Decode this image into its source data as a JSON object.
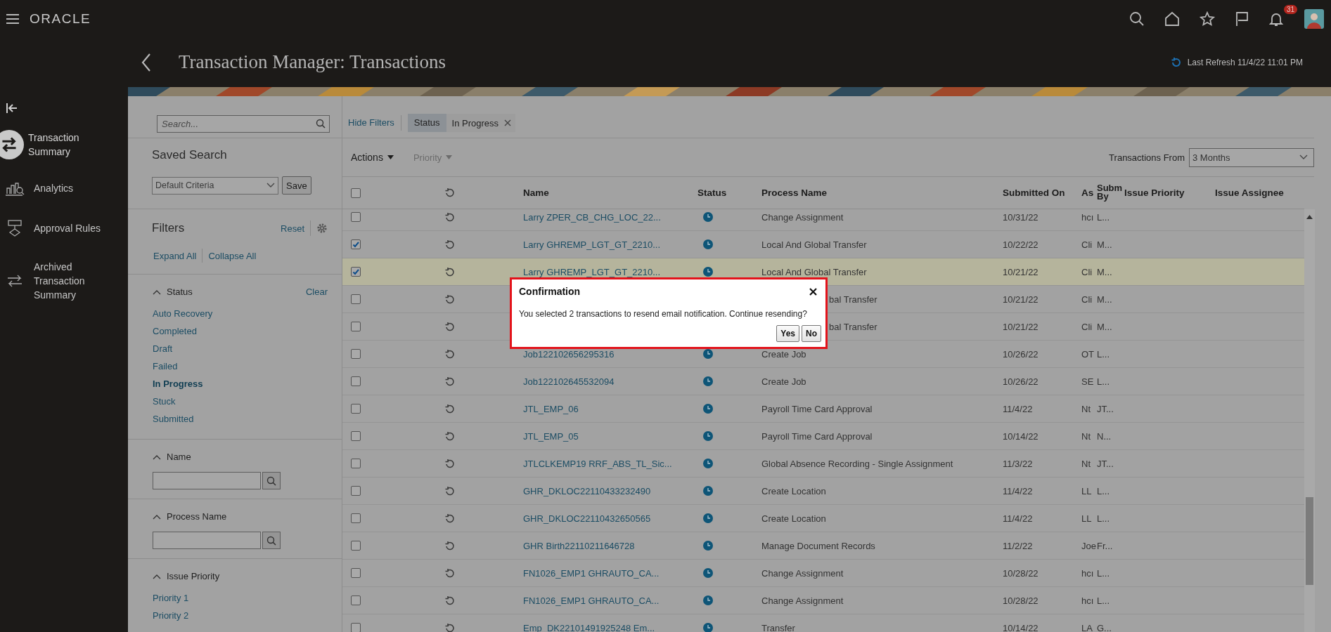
{
  "topbar": {
    "brand": "ORACLE",
    "notification_count": "31"
  },
  "header": {
    "title": "Transaction Manager: Transactions",
    "last_refresh": "Last Refresh 11/4/22 11:01 PM"
  },
  "nav": {
    "items": [
      {
        "label": "Transaction Summary",
        "selected": true
      },
      {
        "label": "Analytics",
        "selected": false
      },
      {
        "label": "Approval Rules",
        "selected": false
      },
      {
        "label": "Archived Transaction Summary",
        "selected": false
      }
    ]
  },
  "filter_panel": {
    "search": {
      "placeholder": "Search..."
    },
    "saved_search_title": "Saved Search",
    "saved_search_value": "Default Criteria",
    "save_button": "Save",
    "filters_title": "Filters",
    "reset": "Reset",
    "expand_all": "Expand All",
    "collapse_all": "Collapse All",
    "sections": [
      {
        "title": "Status",
        "kind": "list",
        "clear": "Clear",
        "items": [
          {
            "label": "Auto Recovery",
            "selected": false
          },
          {
            "label": "Completed",
            "selected": false
          },
          {
            "label": "Draft",
            "selected": false
          },
          {
            "label": "Failed",
            "selected": false
          },
          {
            "label": "In Progress",
            "selected": true
          },
          {
            "label": "Stuck",
            "selected": false
          },
          {
            "label": "Submitted",
            "selected": false
          }
        ]
      },
      {
        "title": "Name",
        "kind": "search"
      },
      {
        "title": "Process Name",
        "kind": "search"
      },
      {
        "title": "Issue Priority",
        "kind": "list",
        "items": [
          {
            "label": "Priority 1",
            "selected": false
          },
          {
            "label": "Priority 2",
            "selected": false
          }
        ]
      }
    ]
  },
  "toolbar": {
    "hide_filters": "Hide Filters",
    "chip": {
      "label": "Status",
      "value": "In Progress"
    },
    "actions": "Actions",
    "priority": {
      "label": "Priority",
      "disabled": true
    },
    "transactions_from_label": "Transactions From",
    "transactions_from_value": "3 Months"
  },
  "table": {
    "header_checked": false,
    "columns": [
      "Name",
      "Status",
      "Process Name",
      "Submitted On",
      "As",
      "Subm By",
      "Issue Priority",
      "Issue Assignee"
    ],
    "rows": [
      {
        "checked": false,
        "selected": false,
        "name": "Larry ZPER_CB_CHG_LOC_22...",
        "process": "Change Assignment",
        "submitted": "10/31/22",
        "as": "hcı",
        "submitted_by": "L..."
      },
      {
        "checked": true,
        "selected": false,
        "name": "Larry GHREMP_LGT_GT_2210...",
        "process": "Local And Global Transfer",
        "submitted": "10/22/22",
        "as": "Cli",
        "submitted_by": "M..."
      },
      {
        "checked": true,
        "selected": true,
        "name": "Larry GHREMP_LGT_GT_2210...",
        "process": "Local And Global Transfer",
        "submitted": "10/21/22",
        "as": "Cli",
        "submitted_by": "M..."
      },
      {
        "checked": false,
        "selected": false,
        "process": "bal Transfer",
        "process_clipped": true,
        "submitted": "10/21/22",
        "as": "Cli",
        "submitted_by": "M..."
      },
      {
        "checked": false,
        "selected": false,
        "process": "bal Transfer",
        "process_clipped": true,
        "submitted": "10/21/22",
        "as": "Cli",
        "submitted_by": "M..."
      },
      {
        "checked": false,
        "selected": false,
        "name": "Job122102656295316",
        "process": "Create Job",
        "submitted": "10/26/22",
        "as": "OT",
        "submitted_by": "L..."
      },
      {
        "checked": false,
        "selected": false,
        "name": "Job122102645532094",
        "process": "Create Job",
        "submitted": "10/26/22",
        "as": "SE",
        "submitted_by": "L..."
      },
      {
        "checked": false,
        "selected": false,
        "name": "JTL_EMP_06",
        "process": "Payroll Time Card Approval",
        "submitted": "11/4/22",
        "as": "Nt",
        "submitted_by": "JT..."
      },
      {
        "checked": false,
        "selected": false,
        "name": "JTL_EMP_05",
        "process": "Payroll Time Card Approval",
        "submitted": "10/14/22",
        "as": "Nt",
        "submitted_by": "N..."
      },
      {
        "checked": false,
        "selected": false,
        "name": "JTLCLKEMP19 RRF_ABS_TL_Sic...",
        "process": "Global Absence Recording - Single Assignment",
        "submitted": "11/3/22",
        "as": "Nt",
        "submitted_by": "JT..."
      },
      {
        "checked": false,
        "selected": false,
        "name": "GHR_DKLOC22110433232490",
        "process": "Create Location",
        "submitted": "11/4/22",
        "as": "LL",
        "submitted_by": "L..."
      },
      {
        "checked": false,
        "selected": false,
        "name": "GHR_DKLOC22110432650565",
        "process": "Create Location",
        "submitted": "11/4/22",
        "as": "LL",
        "submitted_by": "L..."
      },
      {
        "checked": false,
        "selected": false,
        "name": "GHR Birth22110211646728",
        "process": "Manage Document Records",
        "submitted": "11/2/22",
        "as": "Joe",
        "submitted_by": "Fr..."
      },
      {
        "checked": false,
        "selected": false,
        "name": "FN1026_EMP1 GHRAUTO_CA...",
        "process": "Change Assignment",
        "submitted": "10/28/22",
        "as": "hcı",
        "submitted_by": "L..."
      },
      {
        "checked": false,
        "selected": false,
        "name": "FN1026_EMP1 GHRAUTO_CA...",
        "process": "Change Assignment",
        "submitted": "10/28/22",
        "as": "hcı",
        "submitted_by": "L..."
      },
      {
        "checked": false,
        "selected": false,
        "name": "Emp_DK22101491925248 Em...",
        "process": "Transfer",
        "submitted": "10/14/22",
        "as": "LA",
        "submitted_by": "G..."
      }
    ]
  },
  "dialog": {
    "title": "Confirmation",
    "message": "You selected 2 transactions to resend email notification. Continue resending?",
    "buttons": [
      "Yes",
      "No"
    ]
  }
}
